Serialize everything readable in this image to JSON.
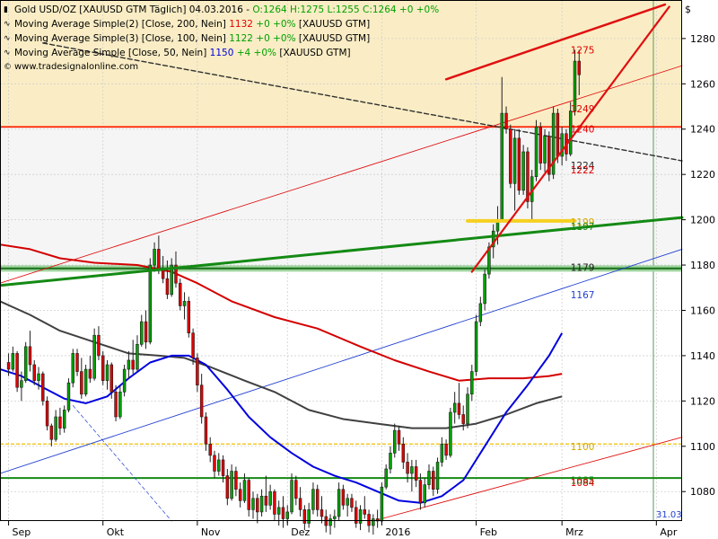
{
  "legend": {
    "title_name": "Gold USD/OZ [XAUUSD GTM",
    "title_period": "Täglich] 04.03.2016",
    "title_open": "O:1264",
    "title_hl": "H:1275 L:1255",
    "title_close": "C:1264 +0 +0%",
    "ma200_label": "Moving Average Simple(2) [Close, 200, Nein]",
    "ma200_value": "1132",
    "ma200_change": "+0 +0%",
    "ma200_source": "[XAUUSD GTM]",
    "ma100_label": "Moving Average Simple(3) [Close, 100, Nein]",
    "ma100_value": "1122",
    "ma100_change": "+0 +0%",
    "ma100_source": "[XAUUSD GTM]",
    "ma50_label": "Moving Average Simple [Close, 50, Nein]",
    "ma50_value": "1150",
    "ma50_change": "+4 +0%",
    "ma50_source": "[XAUUSD GTM]",
    "watermark": "www.tradesignalonline.com"
  },
  "colors": {
    "up": "#00a000",
    "down": "#e00000",
    "ma50": "#0000e0",
    "ma100": "#404040",
    "ma200": "#d40000",
    "highlight": "#faedc5",
    "green_band": "#9fd49f",
    "yellow_line": "#f5d020",
    "trend_green": "#148a14",
    "trend_red": "#e01010"
  },
  "chart_data": {
    "type": "candlestick",
    "y_axis_unit": "$",
    "ylim": [
      1067,
      1297
    ],
    "y_ticks": [
      1080,
      1100,
      1120,
      1140,
      1160,
      1180,
      1200,
      1220,
      1240,
      1260,
      1280
    ],
    "x_ticks": [
      {
        "label": "Sep",
        "i": 0
      },
      {
        "label": "Okt",
        "i": 22
      },
      {
        "label": "Nov",
        "i": 44
      },
      {
        "label": "Dez",
        "i": 65
      },
      {
        "label": "2016",
        "i": 87
      },
      {
        "label": "Feb",
        "i": 109
      },
      {
        "label": "Mrz",
        "i": 129
      },
      {
        "label": "Apr",
        "i": 151
      }
    ],
    "x_range": [
      -2,
      157
    ],
    "current_date_marker": {
      "i": 157,
      "label": "31.03"
    },
    "ohlc": [
      [
        1137,
        1141,
        1131,
        1134
      ],
      [
        1134,
        1144,
        1133,
        1141
      ],
      [
        1141,
        1142,
        1124,
        1126
      ],
      [
        1126,
        1133,
        1120,
        1129
      ],
      [
        1129,
        1146,
        1128,
        1144
      ],
      [
        1144,
        1151,
        1133,
        1136
      ],
      [
        1136,
        1138,
        1127,
        1129
      ],
      [
        1129,
        1135,
        1125,
        1132
      ],
      [
        1132,
        1133,
        1118,
        1120
      ],
      [
        1120,
        1122,
        1107,
        1109
      ],
      [
        1109,
        1110,
        1100,
        1103
      ],
      [
        1103,
        1116,
        1102,
        1113
      ],
      [
        1113,
        1117,
        1105,
        1108
      ],
      [
        1108,
        1118,
        1106,
        1116
      ],
      [
        1116,
        1130,
        1115,
        1128
      ],
      [
        1128,
        1143,
        1126,
        1141
      ],
      [
        1141,
        1143,
        1131,
        1133
      ],
      [
        1133,
        1139,
        1121,
        1123
      ],
      [
        1123,
        1136,
        1122,
        1134
      ],
      [
        1134,
        1140,
        1128,
        1130
      ],
      [
        1130,
        1152,
        1129,
        1149
      ],
      [
        1149,
        1153,
        1138,
        1140
      ],
      [
        1140,
        1142,
        1127,
        1129
      ],
      [
        1129,
        1138,
        1125,
        1136
      ],
      [
        1136,
        1137,
        1121,
        1124
      ],
      [
        1124,
        1127,
        1111,
        1113
      ],
      [
        1113,
        1127,
        1112,
        1124
      ],
      [
        1124,
        1136,
        1122,
        1134
      ],
      [
        1134,
        1142,
        1130,
        1138
      ],
      [
        1138,
        1147,
        1132,
        1134
      ],
      [
        1134,
        1149,
        1133,
        1145
      ],
      [
        1145,
        1158,
        1144,
        1155
      ],
      [
        1155,
        1160,
        1143,
        1146
      ],
      [
        1146,
        1183,
        1145,
        1180
      ],
      [
        1180,
        1190,
        1177,
        1187
      ],
      [
        1187,
        1193,
        1176,
        1178
      ],
      [
        1178,
        1184,
        1172,
        1174
      ],
      [
        1174,
        1182,
        1165,
        1167
      ],
      [
        1167,
        1183,
        1166,
        1180
      ],
      [
        1180,
        1186,
        1170,
        1172
      ],
      [
        1172,
        1174,
        1160,
        1162
      ],
      [
        1162,
        1168,
        1156,
        1164
      ],
      [
        1164,
        1166,
        1148,
        1150
      ],
      [
        1150,
        1152,
        1136,
        1139
      ],
      [
        1139,
        1141,
        1124,
        1127
      ],
      [
        1127,
        1132,
        1110,
        1113
      ],
      [
        1113,
        1115,
        1098,
        1101
      ],
      [
        1101,
        1104,
        1093,
        1096
      ],
      [
        1096,
        1098,
        1086,
        1089
      ],
      [
        1089,
        1097,
        1087,
        1094
      ],
      [
        1094,
        1096,
        1084,
        1087
      ],
      [
        1087,
        1090,
        1074,
        1077
      ],
      [
        1077,
        1092,
        1076,
        1089
      ],
      [
        1089,
        1091,
        1078,
        1081
      ],
      [
        1081,
        1084,
        1073,
        1076
      ],
      [
        1076,
        1088,
        1075,
        1085
      ],
      [
        1085,
        1086,
        1069,
        1072
      ],
      [
        1072,
        1080,
        1068,
        1077
      ],
      [
        1077,
        1079,
        1066,
        1071
      ],
      [
        1071,
        1081,
        1069,
        1078
      ],
      [
        1078,
        1087,
        1071,
        1074
      ],
      [
        1074,
        1083,
        1072,
        1080
      ],
      [
        1080,
        1081,
        1067,
        1070
      ],
      [
        1070,
        1076,
        1065,
        1073
      ],
      [
        1073,
        1078,
        1064,
        1068
      ],
      [
        1068,
        1074,
        1066,
        1071
      ],
      [
        1071,
        1088,
        1070,
        1085
      ],
      [
        1085,
        1087,
        1074,
        1077
      ],
      [
        1077,
        1082,
        1069,
        1072
      ],
      [
        1072,
        1074,
        1063,
        1066
      ],
      [
        1066,
        1075,
        1064,
        1072
      ],
      [
        1072,
        1084,
        1070,
        1081
      ],
      [
        1081,
        1083,
        1069,
        1072
      ],
      [
        1072,
        1078,
        1066,
        1069
      ],
      [
        1069,
        1072,
        1062,
        1065
      ],
      [
        1065,
        1070,
        1061,
        1068
      ],
      [
        1068,
        1072,
        1064,
        1069
      ],
      [
        1069,
        1084,
        1067,
        1081
      ],
      [
        1081,
        1083,
        1072,
        1074
      ],
      [
        1074,
        1079,
        1069,
        1077
      ],
      [
        1077,
        1079,
        1071,
        1073
      ],
      [
        1073,
        1076,
        1064,
        1066
      ],
      [
        1066,
        1074,
        1063,
        1072
      ],
      [
        1072,
        1078,
        1068,
        1070
      ],
      [
        1070,
        1072,
        1062,
        1065
      ],
      [
        1065,
        1070,
        1061,
        1068
      ],
      [
        1068,
        1072,
        1064,
        1067
      ],
      [
        1067,
        1084,
        1066,
        1082
      ],
      [
        1082,
        1092,
        1081,
        1090
      ],
      [
        1090,
        1100,
        1088,
        1097
      ],
      [
        1097,
        1110,
        1095,
        1107
      ],
      [
        1107,
        1109,
        1098,
        1101
      ],
      [
        1101,
        1104,
        1090,
        1093
      ],
      [
        1093,
        1097,
        1084,
        1088
      ],
      [
        1088,
        1094,
        1080,
        1091
      ],
      [
        1091,
        1094,
        1082,
        1085
      ],
      [
        1085,
        1088,
        1072,
        1075
      ],
      [
        1075,
        1086,
        1073,
        1083
      ],
      [
        1083,
        1092,
        1081,
        1089
      ],
      [
        1089,
        1091,
        1078,
        1081
      ],
      [
        1081,
        1095,
        1079,
        1093
      ],
      [
        1093,
        1104,
        1091,
        1101
      ],
      [
        1101,
        1103,
        1094,
        1096
      ],
      [
        1096,
        1117,
        1095,
        1115
      ],
      [
        1115,
        1124,
        1110,
        1119
      ],
      [
        1119,
        1128,
        1112,
        1114
      ],
      [
        1114,
        1118,
        1107,
        1110
      ],
      [
        1110,
        1126,
        1108,
        1123
      ],
      [
        1123,
        1136,
        1120,
        1133
      ],
      [
        1133,
        1158,
        1131,
        1155
      ],
      [
        1155,
        1166,
        1153,
        1163
      ],
      [
        1163,
        1178,
        1160,
        1176
      ],
      [
        1176,
        1190,
        1174,
        1188
      ],
      [
        1188,
        1198,
        1183,
        1195
      ],
      [
        1195,
        1206,
        1189,
        1200
      ],
      [
        1200,
        1263,
        1199,
        1247
      ],
      [
        1247,
        1250,
        1238,
        1240
      ],
      [
        1240,
        1242,
        1214,
        1216
      ],
      [
        1216,
        1240,
        1204,
        1236
      ],
      [
        1236,
        1240,
        1211,
        1213
      ],
      [
        1213,
        1233,
        1211,
        1230
      ],
      [
        1230,
        1232,
        1205,
        1208
      ],
      [
        1208,
        1222,
        1200,
        1219
      ],
      [
        1219,
        1244,
        1217,
        1241
      ],
      [
        1241,
        1243,
        1222,
        1225
      ],
      [
        1225,
        1240,
        1221,
        1237
      ],
      [
        1237,
        1239,
        1217,
        1220
      ],
      [
        1220,
        1250,
        1218,
        1247
      ],
      [
        1247,
        1249,
        1225,
        1228
      ],
      [
        1228,
        1241,
        1224,
        1238
      ],
      [
        1238,
        1240,
        1226,
        1229
      ],
      [
        1229,
        1252,
        1228,
        1248
      ],
      [
        1248,
        1275,
        1246,
        1270
      ],
      [
        1270,
        1275,
        1255,
        1264
      ]
    ],
    "series": [
      {
        "name": "Moving Average Simple(2) [Close, 200, Nein]",
        "color": "#d40000",
        "points": [
          [
            -2,
            1189
          ],
          [
            5,
            1187
          ],
          [
            12,
            1183
          ],
          [
            20,
            1181
          ],
          [
            30,
            1180
          ],
          [
            38,
            1177
          ],
          [
            44,
            1172
          ],
          [
            52,
            1164
          ],
          [
            62,
            1157
          ],
          [
            72,
            1152
          ],
          [
            82,
            1144
          ],
          [
            90,
            1138
          ],
          [
            98,
            1133
          ],
          [
            105,
            1129
          ],
          [
            112,
            1130
          ],
          [
            120,
            1130
          ],
          [
            126,
            1131
          ],
          [
            129,
            1132
          ]
        ]
      },
      {
        "name": "Moving Average Simple(3) [Close, 100, Nein]",
        "color": "#404040",
        "points": [
          [
            -2,
            1164
          ],
          [
            5,
            1158
          ],
          [
            12,
            1151
          ],
          [
            20,
            1146
          ],
          [
            28,
            1141
          ],
          [
            35,
            1140
          ],
          [
            41,
            1139
          ],
          [
            47,
            1135
          ],
          [
            55,
            1129
          ],
          [
            62,
            1124
          ],
          [
            70,
            1116
          ],
          [
            78,
            1112
          ],
          [
            86,
            1110
          ],
          [
            94,
            1108
          ],
          [
            102,
            1108
          ],
          [
            109,
            1110
          ],
          [
            116,
            1114
          ],
          [
            123,
            1119
          ],
          [
            129,
            1122
          ]
        ]
      },
      {
        "name": "Moving Average Simple [Close, 50, Nein]",
        "color": "#0000e0",
        "points": [
          [
            -2,
            1134
          ],
          [
            3,
            1131
          ],
          [
            8,
            1126
          ],
          [
            13,
            1121
          ],
          [
            18,
            1119
          ],
          [
            23,
            1122
          ],
          [
            28,
            1130
          ],
          [
            33,
            1137
          ],
          [
            38,
            1140
          ],
          [
            42,
            1140
          ],
          [
            46,
            1136
          ],
          [
            51,
            1125
          ],
          [
            56,
            1113
          ],
          [
            61,
            1104
          ],
          [
            66,
            1097
          ],
          [
            71,
            1091
          ],
          [
            76,
            1087
          ],
          [
            81,
            1084
          ],
          [
            86,
            1080
          ],
          [
            91,
            1076
          ],
          [
            96,
            1075
          ],
          [
            101,
            1078
          ],
          [
            106,
            1085
          ],
          [
            111,
            1100
          ],
          [
            116,
            1115
          ],
          [
            121,
            1127
          ],
          [
            126,
            1140
          ],
          [
            129,
            1150
          ]
        ]
      }
    ],
    "horizontal_lines": [
      {
        "value": 1241,
        "color": "#ff2000",
        "width": 1.8
      },
      {
        "value": 1178.5,
        "color": "#9fd49f",
        "width": 7
      },
      {
        "value": 1178.5,
        "color": "#207520",
        "width": 2.2
      },
      {
        "value": 1086,
        "color": "#148a14",
        "width": 2
      },
      {
        "value": 1101,
        "color": "#f0c000",
        "width": 1.2,
        "dash": "4,2"
      }
    ],
    "highlight_zone": {
      "from": 1241,
      "to": 1297
    },
    "trendlines": [
      {
        "from": [
          -2,
          1171
        ],
        "to": [
          157,
          1201
        ],
        "color": "#148a14",
        "width": 3
      },
      {
        "from": [
          107,
          1199.5
        ],
        "to": [
          132,
          1199.5
        ],
        "color": "#f5d020",
        "width": 4
      },
      {
        "from": [
          102,
          1262
        ],
        "to": [
          153,
          1295
        ],
        "color": "#e01010",
        "width": 2.5
      },
      {
        "from": [
          108,
          1177
        ],
        "to": [
          154,
          1294
        ],
        "color": "#e01010",
        "width": 2.2
      },
      {
        "from": [
          -2,
          1172
        ],
        "to": [
          157,
          1268
        ],
        "color": "#e01010",
        "width": 0.9
      },
      {
        "from": [
          -2,
          1088
        ],
        "to": [
          157,
          1187
        ],
        "color": "#2040d0",
        "width": 0.9
      },
      {
        "from": [
          85,
          1067
        ],
        "to": [
          157,
          1104
        ],
        "color": "#e01010",
        "width": 0.9
      },
      {
        "from": [
          8,
          1278
        ],
        "to": [
          157,
          1226
        ],
        "color": "#303030",
        "width": 1.4,
        "dash": "5,3"
      },
      {
        "from": [
          15,
          1118
        ],
        "to": [
          38,
          1067
        ],
        "color": "#2040d0",
        "width": 0.7,
        "dash": "4,3"
      }
    ],
    "annotations": [
      {
        "text": "1275",
        "value": 1275,
        "i": 131,
        "color": "#e00000"
      },
      {
        "text": "1249",
        "value": 1249,
        "i": 131,
        "color": "#e00000"
      },
      {
        "text": "1240",
        "value": 1240,
        "i": 131,
        "color": "#e00000"
      },
      {
        "text": "1224",
        "value": 1224,
        "i": 131,
        "color": "#202020"
      },
      {
        "text": "1222",
        "value": 1222,
        "i": 131,
        "color": "#e00000"
      },
      {
        "text": "1199",
        "value": 1199,
        "i": 131,
        "color": "#d4a800"
      },
      {
        "text": "1197",
        "value": 1197,
        "i": 131,
        "color": "#148a14"
      },
      {
        "text": "1179",
        "value": 1179,
        "i": 131,
        "color": "#202020"
      },
      {
        "text": "1167",
        "value": 1167,
        "i": 131,
        "color": "#2040d0"
      },
      {
        "text": "1100",
        "value": 1100,
        "i": 131,
        "color": "#d4a800"
      },
      {
        "text": "1085",
        "value": 1085,
        "i": 131,
        "color": "#148a14"
      },
      {
        "text": "1084",
        "value": 1084,
        "i": 131,
        "color": "#e00000"
      }
    ]
  }
}
